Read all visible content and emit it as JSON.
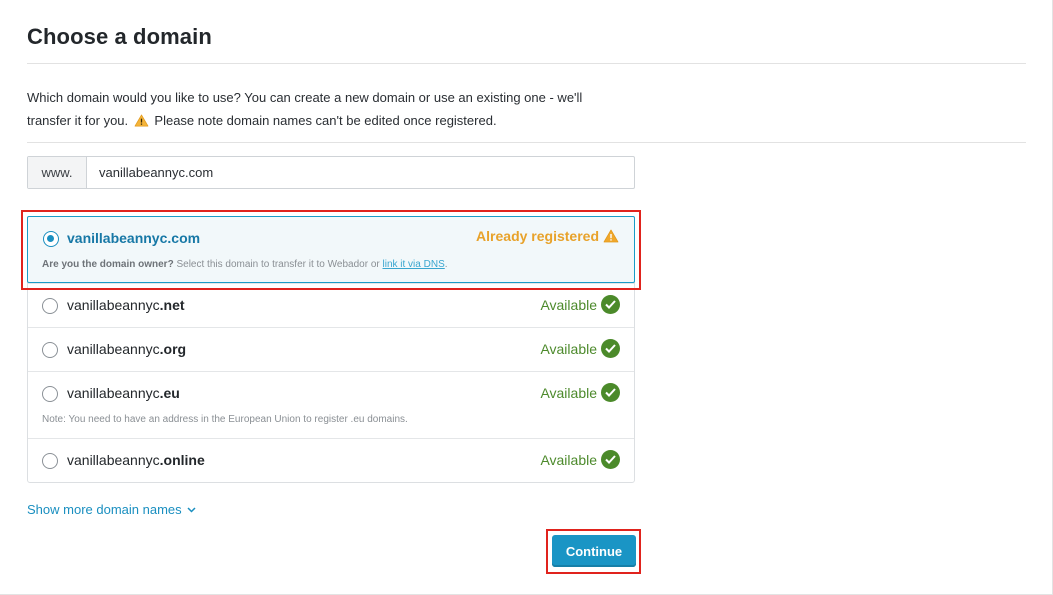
{
  "page": {
    "title": "Choose a domain",
    "description_part1": "Which domain would you like to use? You can create a new domain or use an existing one - we'll transfer it for you.",
    "description_part2": "Please note domain names can't be edited once registered."
  },
  "domain_input": {
    "prefix": "www.",
    "value": "vanillabeannyc.com"
  },
  "options": [
    {
      "base": "vanillabeannyc",
      "tld": ".com",
      "status": "Already registered",
      "selected": true,
      "note_bold": "Are you the domain owner?",
      "note_text": "Select this domain to transfer it to Webador or",
      "note_link": "link it via DNS",
      "note_end": "."
    },
    {
      "base": "vanillabeannyc",
      "tld": ".net",
      "status": "Available",
      "selected": false
    },
    {
      "base": "vanillabeannyc",
      "tld": ".org",
      "status": "Available",
      "selected": false
    },
    {
      "base": "vanillabeannyc",
      "tld": ".eu",
      "status": "Available",
      "selected": false,
      "note": "Note: You need to have an address in the European Union to register .eu domains."
    },
    {
      "base": "vanillabeannyc",
      "tld": ".online",
      "status": "Available",
      "selected": false
    }
  ],
  "show_more_label": "Show more domain names",
  "continue_label": "Continue",
  "colors": {
    "accent": "#1a95c5",
    "available": "#4b8a2a",
    "warning": "#e8a22a",
    "highlight": "#e0231d"
  },
  "icons": {
    "warning": "warning-triangle-icon",
    "available": "checkmark-circle-icon",
    "chevron": "chevron-down-icon"
  }
}
